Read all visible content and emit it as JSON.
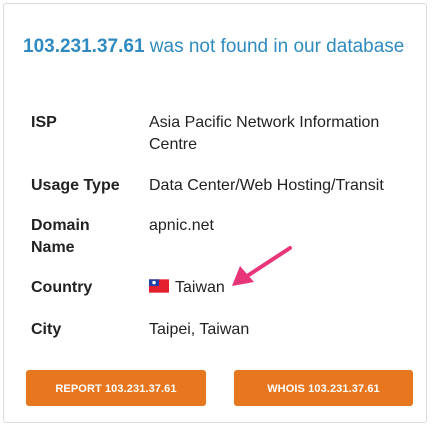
{
  "headline": {
    "ip": "103.231.37.61",
    "message": " was not found in our database"
  },
  "details": [
    {
      "label": "ISP",
      "value": "Asia Pacific Network Information Centre"
    },
    {
      "label": "Usage Type",
      "value": "Data Center/Web Hosting/Transit"
    },
    {
      "label": "Domain Name",
      "value": "apnic.net"
    },
    {
      "label": "Country",
      "value": "Taiwan",
      "flag": "taiwan-flag-icon"
    },
    {
      "label": "City",
      "value": "Taipei, Taiwan"
    }
  ],
  "buttons": {
    "report": "REPORT 103.231.37.61",
    "whois": "WHOIS 103.231.37.61"
  },
  "colors": {
    "link_blue": "#2f8bbf",
    "button_orange": "#e7761f",
    "arrow_pink": "#e8357a"
  },
  "icons": {
    "annotation_arrow": "pink-arrow-icon"
  }
}
